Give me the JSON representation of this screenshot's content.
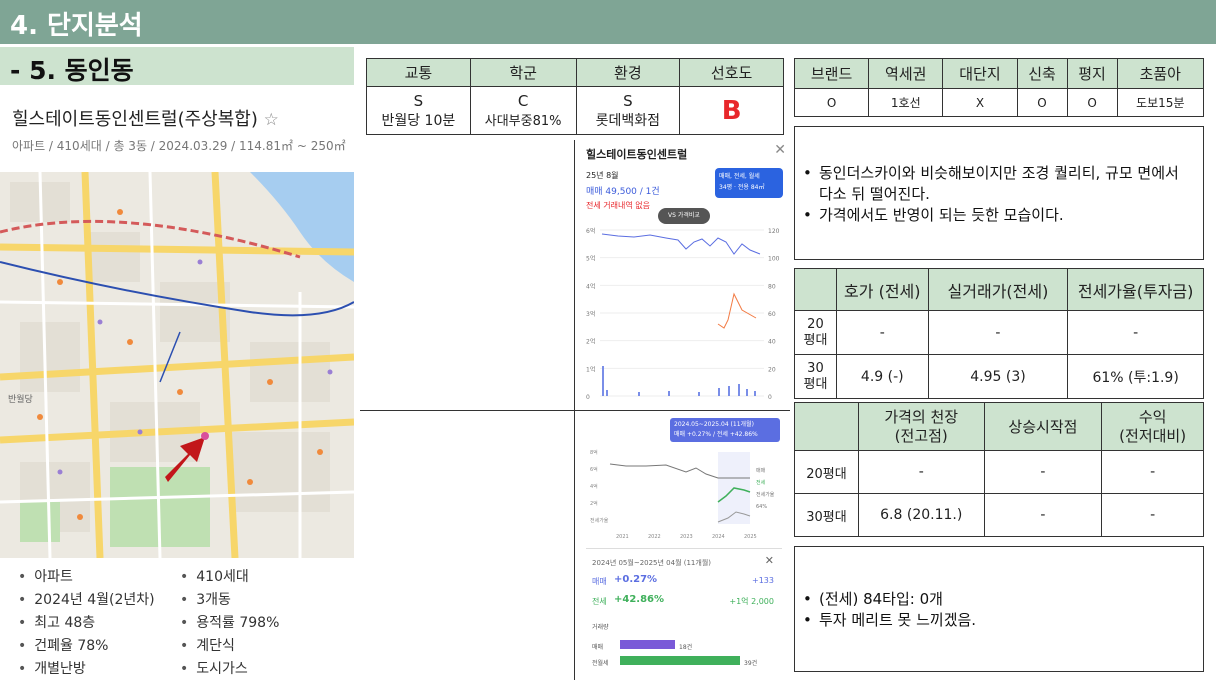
{
  "header": {
    "section_title": "4. 단지분석",
    "subsection_title": "- 5. 동인동"
  },
  "complex": {
    "name": "힐스테이트동인센트럴(주상복합)",
    "star": "☆",
    "meta": "아파트 / 410세대 / 총 3동 / 2024.03.29 / 114.81㎡ ~ 250㎡"
  },
  "facts_left": [
    "아파트",
    "2024년 4월(2년차)",
    "최고 48층",
    "건폐율 78%",
    "개별난방"
  ],
  "facts_right": [
    "410세대",
    "3개동",
    "용적률 798%",
    "계단식",
    "도시가스"
  ],
  "grade_table": {
    "headers": [
      "교통",
      "학군",
      "환경",
      "선호도"
    ],
    "grades": [
      "S",
      "C",
      "S",
      "B"
    ],
    "details": [
      "반월당 10분",
      "사대부중81%",
      "롯데백화점",
      ""
    ]
  },
  "feature_table": {
    "headers": [
      "브랜드",
      "역세권",
      "대단지",
      "신축",
      "평지",
      "초품아"
    ],
    "values": [
      "O",
      "1호선",
      "X",
      "O",
      "O",
      "도보15분"
    ]
  },
  "note1": [
    "동인더스카이와 비슷해보이지만 조경 퀄리티, 규모 면에서 다소 뒤 떨어진다.",
    "가격에서도 반영이 되는 듯한 모습이다."
  ],
  "price_table": {
    "headers": [
      "",
      "호가 (전세)",
      "실거래가(전세)",
      "전세가율(투자금)"
    ],
    "rows": [
      {
        "label": "20\n평대",
        "cells": [
          "-",
          "-",
          "-"
        ]
      },
      {
        "label": "30\n평대",
        "cells": [
          "4.9 (-)",
          "4.95 (3)",
          "61% (투:1.9)"
        ]
      }
    ]
  },
  "peak_table": {
    "headers": [
      "",
      "가격의 천장\n(전고점)",
      "상승시작점",
      "수익\n(전저대비)"
    ],
    "rows": [
      {
        "label": "20평대",
        "cells": [
          "-",
          "-",
          "-"
        ]
      },
      {
        "label": "30평대",
        "cells": [
          "6.8 (20.11.)",
          "-",
          "-"
        ]
      }
    ]
  },
  "note2": [
    "(전세) 84타입: 0개",
    "투자 메리트 못 느끼겠음."
  ],
  "app1": {
    "title": "힐스테이트동인센트럴",
    "date": "25년 8월",
    "sale": "매매 49,500 / 1건",
    "jeonse": "전세 거래내역 없음",
    "filter": "매매, 전세, 월세",
    "filter2": "34평 · 전용 84㎡",
    "compare": "VS 가격비교",
    "y_left": [
      "6억",
      "5억",
      "4억",
      "3억",
      "2억",
      "1억",
      "0"
    ],
    "y_right": [
      "120",
      "100",
      "80",
      "60",
      "40",
      "20",
      "0"
    ]
  },
  "app2": {
    "period": "2024.05~2025.04 (11개월)",
    "changes": "매매 +0.27%  /  전세 +42.86%",
    "x_labels": [
      "2021",
      "2022",
      "2023",
      "2024",
      "2025"
    ],
    "legend": [
      "매매",
      "전세",
      "전세가율",
      "64%"
    ],
    "y_labels": [
      "8억",
      "6억",
      "4억",
      "2억",
      "전세가율"
    ],
    "summary_period": "2024년 05월~2025년 04월 (11개월)",
    "sale_label": "매매",
    "sale_pct": "+0.27%",
    "sale_amt": "+133",
    "jeonse_label": "전세",
    "jeonse_pct": "+42.86%",
    "jeonse_amt": "+1억 2,000",
    "volume_label": "거래량",
    "vol_sale": "매매",
    "vol_sale_n": "18건",
    "vol_jeonse": "전월세",
    "vol_jeonse_n": "39건"
  },
  "map_labels": {
    "subway": "반월당"
  },
  "colors": {
    "topbar": "#7fa595",
    "subbar": "#cde3cf",
    "grade_B": "#e8262a",
    "sale": "#5b6ee1",
    "jeonse": "#3fb05b"
  }
}
